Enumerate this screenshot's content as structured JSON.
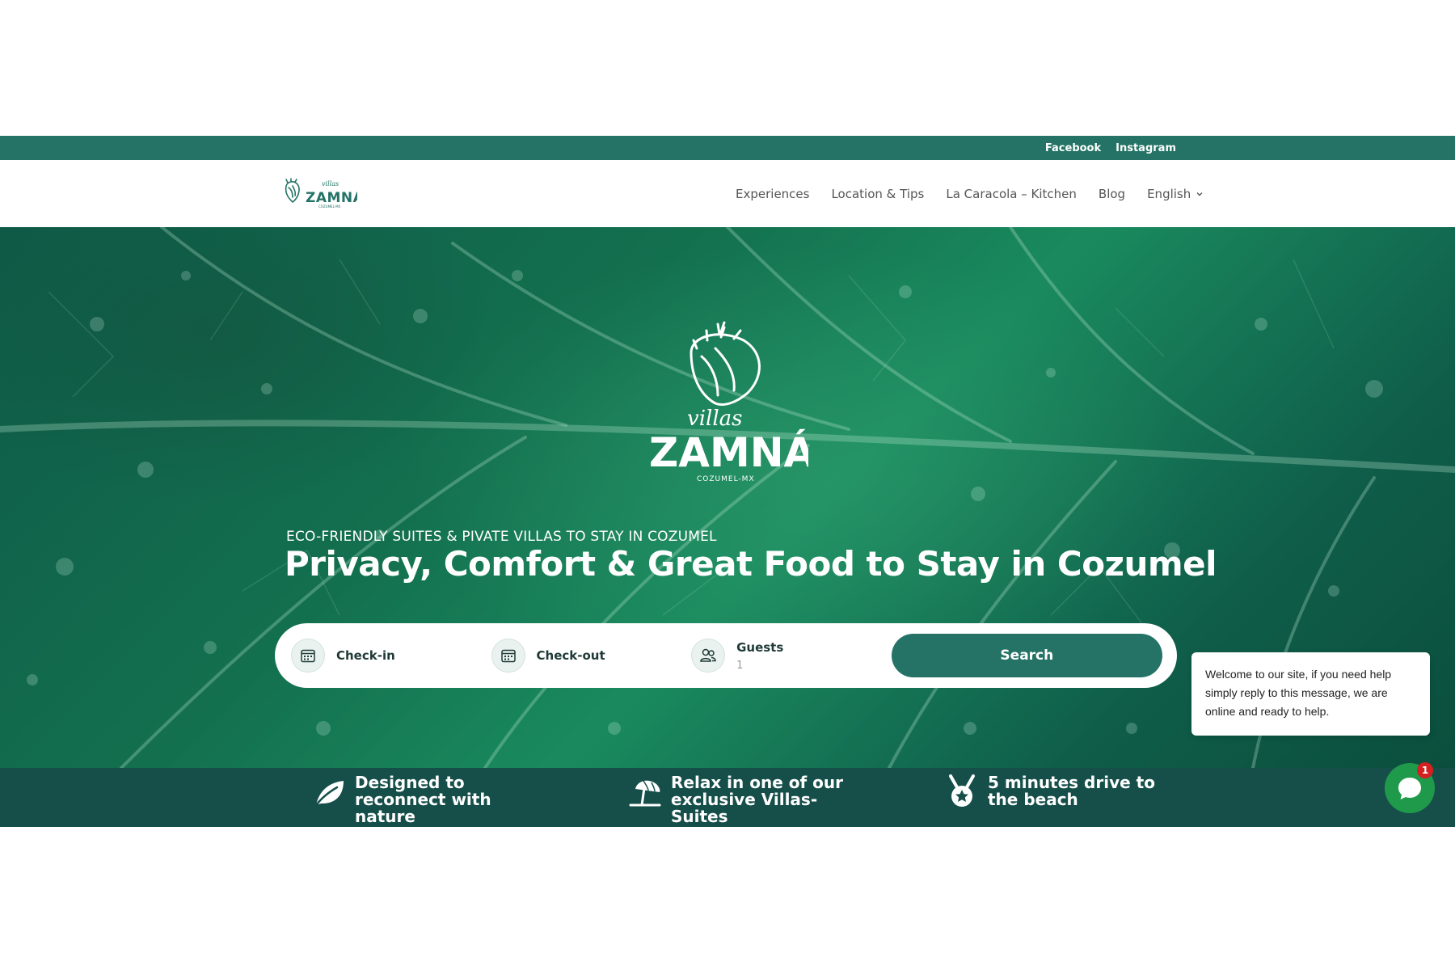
{
  "topbar": {
    "links": [
      "Facebook",
      "Instagram"
    ]
  },
  "header": {
    "logo_alt": "villas ZAMNÁ",
    "nav": [
      "Experiences",
      "Location & Tips",
      "La Caracola – Kitchen",
      "Blog",
      "English"
    ]
  },
  "hero": {
    "logo_word_script": "villas",
    "logo_word_main": "ZAMNÁ",
    "logo_word_sub": "COZUMEL-MX",
    "kicker": "ECO-FRIENDLY SUITES & PIVATE VILLAS TO STAY IN COZUMEL",
    "title": "Privacy, Comfort & Great Food to Stay in Cozumel"
  },
  "booking": {
    "checkin_label": "Check-in",
    "checkout_label": "Check-out",
    "guests_label": "Guests",
    "guests_value": "1",
    "search_label": "Search"
  },
  "chat": {
    "message": "Welcome to our site, if you need help simply reply to this message, we are online and ready to help.",
    "badge": "1"
  },
  "features": [
    {
      "icon": "leaf-icon",
      "text": "Designed to reconnect with nature"
    },
    {
      "icon": "beach-umbrella-icon",
      "text": "Relax in one of our exclusive Villas-Suites"
    },
    {
      "icon": "medal-icon",
      "text": "5 minutes drive to the beach"
    }
  ],
  "colors": {
    "brand": "#247366",
    "features_bg": "#164f4a",
    "chat_green": "#1f9a4a"
  }
}
